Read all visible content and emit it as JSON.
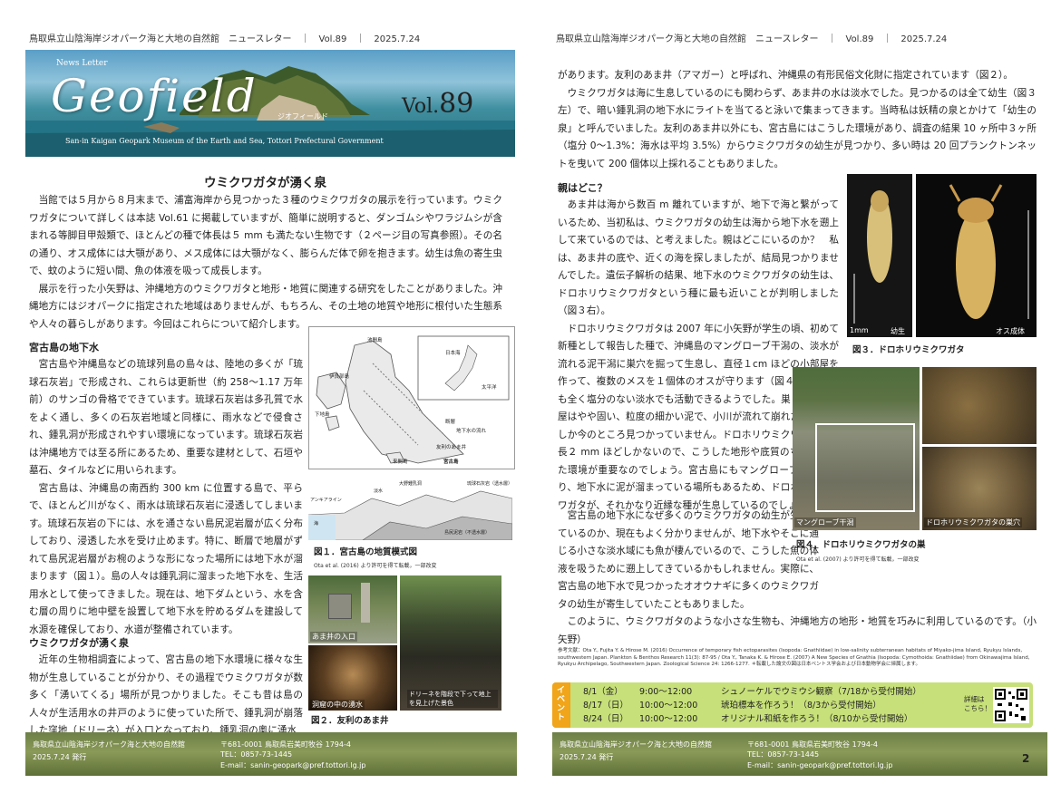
{
  "left": {
    "running_header": "鳥取県立山陰海岸ジオパーク海と大地の自然館　ニュースレター　｜　Vol.89　｜　2025.7.24",
    "banner": {
      "newsletter": "News Letter",
      "title": "Geofield",
      "title_kana": "ジオフィールド",
      "vol_prefix": "Vol.",
      "vol_number": "89",
      "subtitle": "San-in Kaigan Geopark Museum of the Earth and Sea, Tottori Prefectural Government"
    },
    "article_title": "ウミクワガタが湧く泉",
    "intro": [
      "当館では５月から８月末まで、浦富海岸から見つかった３種のウミクワガタの展示を行っています。ウミクワガタについて詳しくは本誌 Vol.61 に掲載していますが、簡単に説明すると、ダンゴムシやワラジムシが含まれる等脚目甲殻類で、ほとんどの種で体長は５ mm も満たない生物です（２ページ目の写真参照）。その名の通り、オス成体には大顎があり、メス成体には大顎がなく、膨らんだ体で卵を抱きます。幼生は魚の寄生虫で、蚊のように短い間、魚の体液を吸って成長します。",
      "展示を行った小矢野は、沖縄地方のウミクワガタと地形・地質に関連する研究をしたことがありました。沖縄地方にはジオパークに指定された地域はありませんが、もちろん、その土地の地質や地形に根付いた生態系や人々の暮らしがあります。今回はこれらについて紹介します。"
    ],
    "section1": {
      "heading": "宮古島の地下水",
      "paragraphs": [
        "宮古島や沖縄島などの琉球列島の島々は、陸地の多くが「琉球石灰岩」で形成され、これらは更新世（約 258〜1.17 万年前）のサンゴの骨格でできています。琉球石灰岩は多孔質で水をよく通し、多くの石灰岩地域と同様に、雨水などで侵食され、鍾乳洞が形成されやすい環境になっています。琉球石灰岩は沖縄地方では至る所にあるため、重要な建材として、石垣や墓石、タイルなどに用いられます。",
        "宮古島は、沖縄島の南西約 300 km に位置する島で、平らで、ほとんど川がなく、雨水は琉球石灰岩に浸透してしまいます。琉球石灰岩の下には、水を通さない島尻泥岩層が広く分布しており、浸透した水を受け止めます。特に、断層で地層がずれて島尻泥岩層がお椀のような形になった場所には地下水が溜まります（図１）。島の人々は鍾乳洞に溜まった地下水を、生活用水として使ってきました。現在は、地下ダムという、水を含む層の周りに地中壁を設置して地下水を貯めるダムを建設して水源を確保しており、水道が整備されています。"
      ]
    },
    "section2": {
      "heading": "ウミクワガタが湧く泉",
      "paragraphs": [
        "近年の生物相調査によって、宮古島の地下水環境に様々な生物が生息していることが分かり、その過程でウミクワガタが数多く「湧いてくる」場所が見つかりました。そこも昔は島の人々が生活用水の井戸のように使っていた所で、鍾乳洞が崩落した窪地（ドリーネ）が入口となっており、鍾乳洞の奥に湧水"
      ]
    },
    "figure1": {
      "map_labels": [
        "池間島",
        "伊良部島",
        "日本海",
        "太平洋",
        "下地島",
        "来間島",
        "宮古島",
        "断層",
        "地下水の流れ",
        "友利のあま井"
      ],
      "section_labels": [
        "アンキアライン",
        "淡水",
        "海",
        "大野鍾乳洞",
        "島尻泥岩（不透水層）",
        "琉球石灰岩（透水層）"
      ],
      "caption": "図１．宮古島の地質模式図",
      "source": "Ota et al. (2016) より許可を得て転載，一部改変"
    },
    "figure2": {
      "labels": [
        "あま井の入口",
        "洞窟の中の湧水",
        "ドリーネを階段で下って地上を見上げた景色"
      ],
      "caption": "図２．友利のあま井"
    },
    "footer": {
      "org": "鳥取県立山陰海岸ジオパーク海と大地の自然館",
      "date": "2025.7.24 発行",
      "address": "〒681-0001 鳥取県岩美町牧谷 1794-4",
      "tel": "TEL：0857-73-1445",
      "email": "E-mail：sanin-geopark@pref.tottori.lg.jp"
    }
  },
  "right": {
    "running_header": "鳥取県立山陰海岸ジオパーク海と大地の自然館　ニュースレター　｜　Vol.89　｜　2025.7.24",
    "top_paragraphs": [
      "があります。友利のあま井（アマガー）と呼ばれ、沖縄県の有形民俗文化財に指定されています（図２）。",
      "ウミクワガタは海に生息しているのにも関わらず、あま井の水は淡水でした。見つかるのは全て幼生（図３左）で、暗い鍾乳洞の地下水にライトを当てると泳いで集まってきます。当時私は妖精の泉とかけて「幼生の泉」と呼んでいました。友利のあま井以外にも、宮古島にはこうした環境があり、調査の結果 10 ヶ所中３ヶ所（塩分 0〜1.3%：海水は平均 3.5%）からウミクワガタの幼生が見つかり、多い時は 20 回プランクトンネットを曳いて 200 個体以上採れることもありました。"
    ],
    "section": {
      "heading": "親はどこ？",
      "paragraphs": [
        "あま井は海から数百 m 離れていますが、地下で海と繋がっているため、当初私は、ウミクワガタの幼生は海から地下水を遡上して来ているのでは、と考えました。親はどこにいるのか？　私は、あま井の底や、近くの海を探しましたが、結局見つかりませんでした。遺伝子解析の結果、地下水のウミクワガタの幼生は、ドロホリウミクワガタという種に最も近いことが判明しました（図３右）。",
        "ドロホリウミクワガタは 2007 年に小矢野が学生の頃、初めて新種として報告した種で、沖縄島のマングローブ干潟の、淡水が流れる泥干潟に巣穴を掘って生息し、直径１cm ほどの小部屋を作って、複数のメスを１個体のオスが守ります（図４）。この種も全く塩分のない淡水でも活動できるようでした。巣となる小部屋はやや固い、粒度の細かい泥で、小川が流れて崩れたところにしか今のところ見つかっていません。ドロホリウミクワガタは全長２ mm ほどしかないので、こうした地形や底質のちょっとした環境が重要なのでしょう。宮古島にもマングローブ干潟があり、地下水に泥が溜まっている場所もあるため、ドロホリウミクワガタが、それかなり近縁な種が生息しているのでしょう。",
        "宮古島の地下水になぜ多くのウミクワガタの幼生が生息しているのか、現在もよく分かりませんが、地下水やそこに通じる小さな淡水域にも魚が棲んでいるので、こうした魚の体液を吸うために遡上してきているかもしれません。実際に、宮古島の地下水で見つかったオオウナギに多くのウミクワガタの幼生が寄生していたこともありました。",
        "このように、ウミクワガタのような小さな生物も、沖縄地方の地形・地質を巧みに利用しているのです。（小矢野）"
      ]
    },
    "figure3": {
      "scale": "1mm",
      "labels": [
        "幼生",
        "オス成体"
      ],
      "caption": "図３．ドロホリウミクワガタ"
    },
    "figure4": {
      "labels": [
        "マングローブ干潟",
        "ドロホリウミクワガタの巣穴"
      ],
      "caption": "図４．ドロホリウミクワガタの巣",
      "source": "Ota et al. (2007) より許可を得て転載，一部改変"
    },
    "references": "参考文献：Ota Y., Fujita Y. & Hirose M. (2016) Occurrence of temporary fish ectoparasites (Isopoda: Gnathiidae) in low-salinity subterranean habitats of Miyako-jima Island, Ryukyu Islands, southwestern Japan. Plankton & Benthos Research 11(3): 87-95 / Ota Y., Tanaka K. & Hirose E. (2007) A New Species of Gnathia (Isopoda: Cymothoida: Gnathiidae) from Okinawajima Island, Ryukyu Archipelago, Southwestern Japan. Zoological Science 24: 1266-1277. ＊転載した論文の図は日本ベントス学会および日本動物学会に帰属します。",
    "event": {
      "tab": "イベント",
      "rows": [
        {
          "date": "8/1（金）",
          "time": "9:00〜12:00",
          "title": "シュノーケルでウミウシ観察（7/18から受付開始）"
        },
        {
          "date": "8/17（日）",
          "time": "10:00〜12:00",
          "title": "琥珀標本を作ろう！（8/3から受付開始）"
        },
        {
          "date": "8/24（日）",
          "time": "10:00〜12:00",
          "title": "オリジナル和紙を作ろう！（8/10から受付開始）"
        }
      ],
      "detail": "詳細は\nこちら！"
    },
    "footer": {
      "org": "鳥取県立山陰海岸ジオパーク海と大地の自然館",
      "date": "2025.7.24 発行",
      "address": "〒681-0001 鳥取県岩美町牧谷 1794-4",
      "tel": "TEL：0857-73-1445",
      "email": "E-mail：sanin-geopark@pref.tottori.lg.jp",
      "page_number": "2"
    }
  },
  "colors": {
    "footer_green": "#7b8c4e",
    "event_green": "#c7e07a",
    "event_tab": "#f0a51a",
    "sea": "#2c7d8e"
  }
}
